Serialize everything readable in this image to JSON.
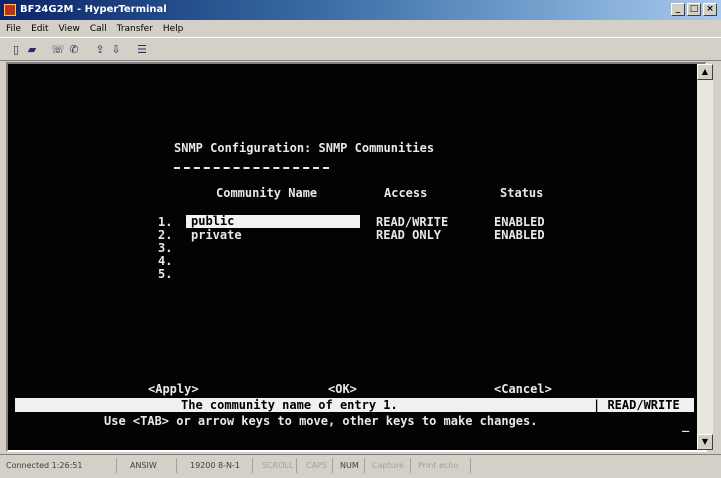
{
  "window": {
    "title": "BF24G2M - HyperTerminal"
  },
  "menu": [
    "File",
    "Edit",
    "View",
    "Call",
    "Transfer",
    "Help"
  ],
  "toolbar": [
    "new-icon",
    "open-icon",
    "connect-icon",
    "disconnect-icon",
    "send-icon",
    "receive-icon",
    "properties-icon"
  ],
  "screen": {
    "heading": "SNMP Configuration: SNMP Communities",
    "columns": {
      "name": "Community Name",
      "access": "Access",
      "status": "Status"
    },
    "rows": [
      {
        "num": "1.",
        "name": "public",
        "access": "READ/WRITE",
        "status": "ENABLED"
      },
      {
        "num": "2.",
        "name": "private",
        "access": "READ ONLY",
        "status": "ENABLED"
      },
      {
        "num": "3.",
        "name": "",
        "access": "",
        "status": ""
      },
      {
        "num": "4.",
        "name": "",
        "access": "",
        "status": ""
      },
      {
        "num": "5.",
        "name": "",
        "access": "",
        "status": ""
      }
    ],
    "actions": {
      "apply": "<Apply>",
      "ok": "<OK>",
      "cancel": "<Cancel>"
    },
    "status_bar": {
      "message": "The community name of entry 1.",
      "mode": "| READ/WRITE"
    },
    "hint": "Use <TAB> or arrow keys to move, other keys to make changes."
  },
  "statusbar": {
    "connected": "Connected 1:26:51",
    "emulation": "ANSIW",
    "settings": "19200 8-N-1",
    "scroll": "SCROLL",
    "caps": "CAPS",
    "num": "NUM",
    "capture": "Capture",
    "echo": "Print echo"
  }
}
